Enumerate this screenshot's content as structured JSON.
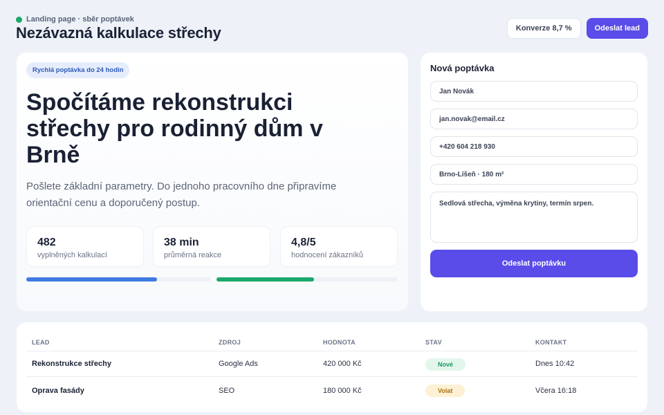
{
  "header": {
    "eyebrow": "Landing page · sběr poptávek",
    "title": "Nezávazná kalkulace střechy",
    "conversion_label": "Konverze 8,7 %",
    "send_lead_label": "Odeslat lead"
  },
  "hero": {
    "chip": "Rychlá poptávka do 24 hodin",
    "headline": "Spočítáme rekonstrukci střechy pro rodinný dům v Brně",
    "subtitle": "Pošlete základní parametry. Do jednoho pracovního dne připravíme orientační cenu a doporučený postup.",
    "stats": [
      {
        "value": "482",
        "label": "vyplněných kalkulací"
      },
      {
        "value": "38 min",
        "label": "průměrná reakce"
      },
      {
        "value": "4,8/5",
        "label": "hodnocení zákazníků"
      }
    ],
    "progress": [
      {
        "fraction": 0.71,
        "color": "#3f7ae0"
      },
      {
        "fraction": 0.54,
        "color": "#1ca86a"
      }
    ]
  },
  "form": {
    "title": "Nová poptávka",
    "name_value": "Jan Novák",
    "email_value": "jan.novak@email.cz",
    "phone_value": "+420 604 218 930",
    "location_value": "Brno-Líšeň · 180 m²",
    "note_value": "Sedlová střecha, výměna krytiny, termín srpen.",
    "submit_label": "Odeslat poptávku"
  },
  "table": {
    "headers": [
      "LEAD",
      "ZDROJ",
      "HODNOTA",
      "STAV",
      "KONTAKT"
    ],
    "rows": [
      {
        "lead": "Rekonstrukce střechy",
        "source": "Google Ads",
        "value": "420 000 Kč",
        "status": "Nové",
        "contact": "Dnes 10:42"
      },
      {
        "lead": "Oprava fasády",
        "source": "SEO",
        "value": "180 000 Kč",
        "status": "Volat",
        "contact": "Včera 16:18"
      }
    ]
  },
  "colors": {
    "accent": "#5a4ce8",
    "live_dot": "#1ca86a",
    "status_new": "#1f9a5c",
    "status_call": "#a8740e"
  }
}
